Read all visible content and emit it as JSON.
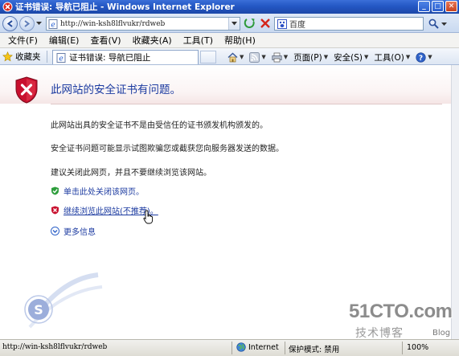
{
  "window": {
    "title": "证书错误: 导航已阻止 - Windows Internet Explorer"
  },
  "address_bar": {
    "url": "http://win-ksh8lflvukr/rdweb"
  },
  "search": {
    "engine_label": "百度"
  },
  "menu": {
    "items": [
      "文件(F)",
      "编辑(E)",
      "查看(V)",
      "收藏夹(A)",
      "工具(T)",
      "帮助(H)"
    ]
  },
  "command_bar": {
    "favorites_label": "收藏夹",
    "tab_title": "证书错误: 导航已阻止",
    "page_label": "页面(P)",
    "safety_label": "安全(S)",
    "tools_label": "工具(O)"
  },
  "content": {
    "heading": "此网站的安全证书有问题。",
    "paragraphs": [
      "此网站出具的安全证书不是由受信任的证书颁发机构颁发的。",
      "安全证书问题可能显示试图欺骗您或截获您向服务器发送的数据。",
      "建议关闭此网页，并且不要继续浏览该网站。"
    ],
    "close_link": "单击此处关闭该网页。",
    "continue_link": "继续浏览此网站(不推荐)。",
    "more_info": "更多信息"
  },
  "status_bar": {
    "url": "http://win-ksh8lflvukr/rdweb",
    "zone": "Internet",
    "protected_mode": "保护模式: 禁用",
    "zoom": "100%"
  },
  "watermark": {
    "brand": "51CTO.com",
    "subtitle": "技术博客",
    "blog": "Blog"
  },
  "colors": {
    "link": "#1b3aa0",
    "title_bar": "#2457c4",
    "error_red": "#c8102e"
  }
}
